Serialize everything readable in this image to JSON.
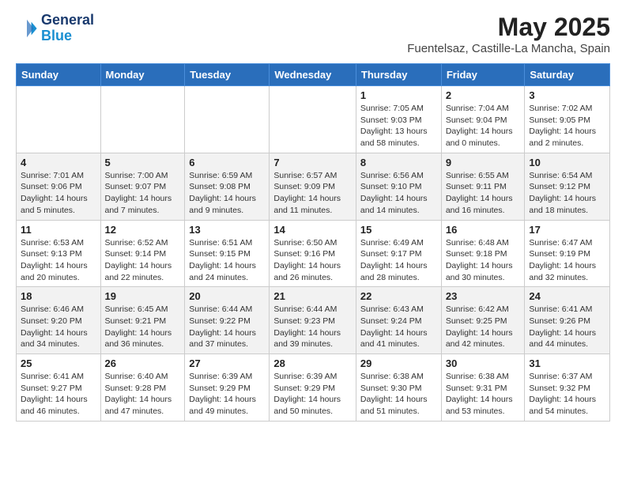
{
  "header": {
    "logo_line1": "General",
    "logo_line2": "Blue",
    "month_title": "May 2025",
    "location": "Fuentelsaz, Castille-La Mancha, Spain"
  },
  "days_of_week": [
    "Sunday",
    "Monday",
    "Tuesday",
    "Wednesday",
    "Thursday",
    "Friday",
    "Saturday"
  ],
  "weeks": [
    [
      {
        "day": "",
        "info": ""
      },
      {
        "day": "",
        "info": ""
      },
      {
        "day": "",
        "info": ""
      },
      {
        "day": "",
        "info": ""
      },
      {
        "day": "1",
        "info": "Sunrise: 7:05 AM\nSunset: 9:03 PM\nDaylight: 13 hours and 58 minutes."
      },
      {
        "day": "2",
        "info": "Sunrise: 7:04 AM\nSunset: 9:04 PM\nDaylight: 14 hours and 0 minutes."
      },
      {
        "day": "3",
        "info": "Sunrise: 7:02 AM\nSunset: 9:05 PM\nDaylight: 14 hours and 2 minutes."
      }
    ],
    [
      {
        "day": "4",
        "info": "Sunrise: 7:01 AM\nSunset: 9:06 PM\nDaylight: 14 hours and 5 minutes."
      },
      {
        "day": "5",
        "info": "Sunrise: 7:00 AM\nSunset: 9:07 PM\nDaylight: 14 hours and 7 minutes."
      },
      {
        "day": "6",
        "info": "Sunrise: 6:59 AM\nSunset: 9:08 PM\nDaylight: 14 hours and 9 minutes."
      },
      {
        "day": "7",
        "info": "Sunrise: 6:57 AM\nSunset: 9:09 PM\nDaylight: 14 hours and 11 minutes."
      },
      {
        "day": "8",
        "info": "Sunrise: 6:56 AM\nSunset: 9:10 PM\nDaylight: 14 hours and 14 minutes."
      },
      {
        "day": "9",
        "info": "Sunrise: 6:55 AM\nSunset: 9:11 PM\nDaylight: 14 hours and 16 minutes."
      },
      {
        "day": "10",
        "info": "Sunrise: 6:54 AM\nSunset: 9:12 PM\nDaylight: 14 hours and 18 minutes."
      }
    ],
    [
      {
        "day": "11",
        "info": "Sunrise: 6:53 AM\nSunset: 9:13 PM\nDaylight: 14 hours and 20 minutes."
      },
      {
        "day": "12",
        "info": "Sunrise: 6:52 AM\nSunset: 9:14 PM\nDaylight: 14 hours and 22 minutes."
      },
      {
        "day": "13",
        "info": "Sunrise: 6:51 AM\nSunset: 9:15 PM\nDaylight: 14 hours and 24 minutes."
      },
      {
        "day": "14",
        "info": "Sunrise: 6:50 AM\nSunset: 9:16 PM\nDaylight: 14 hours and 26 minutes."
      },
      {
        "day": "15",
        "info": "Sunrise: 6:49 AM\nSunset: 9:17 PM\nDaylight: 14 hours and 28 minutes."
      },
      {
        "day": "16",
        "info": "Sunrise: 6:48 AM\nSunset: 9:18 PM\nDaylight: 14 hours and 30 minutes."
      },
      {
        "day": "17",
        "info": "Sunrise: 6:47 AM\nSunset: 9:19 PM\nDaylight: 14 hours and 32 minutes."
      }
    ],
    [
      {
        "day": "18",
        "info": "Sunrise: 6:46 AM\nSunset: 9:20 PM\nDaylight: 14 hours and 34 minutes."
      },
      {
        "day": "19",
        "info": "Sunrise: 6:45 AM\nSunset: 9:21 PM\nDaylight: 14 hours and 36 minutes."
      },
      {
        "day": "20",
        "info": "Sunrise: 6:44 AM\nSunset: 9:22 PM\nDaylight: 14 hours and 37 minutes."
      },
      {
        "day": "21",
        "info": "Sunrise: 6:44 AM\nSunset: 9:23 PM\nDaylight: 14 hours and 39 minutes."
      },
      {
        "day": "22",
        "info": "Sunrise: 6:43 AM\nSunset: 9:24 PM\nDaylight: 14 hours and 41 minutes."
      },
      {
        "day": "23",
        "info": "Sunrise: 6:42 AM\nSunset: 9:25 PM\nDaylight: 14 hours and 42 minutes."
      },
      {
        "day": "24",
        "info": "Sunrise: 6:41 AM\nSunset: 9:26 PM\nDaylight: 14 hours and 44 minutes."
      }
    ],
    [
      {
        "day": "25",
        "info": "Sunrise: 6:41 AM\nSunset: 9:27 PM\nDaylight: 14 hours and 46 minutes."
      },
      {
        "day": "26",
        "info": "Sunrise: 6:40 AM\nSunset: 9:28 PM\nDaylight: 14 hours and 47 minutes."
      },
      {
        "day": "27",
        "info": "Sunrise: 6:39 AM\nSunset: 9:29 PM\nDaylight: 14 hours and 49 minutes."
      },
      {
        "day": "28",
        "info": "Sunrise: 6:39 AM\nSunset: 9:29 PM\nDaylight: 14 hours and 50 minutes."
      },
      {
        "day": "29",
        "info": "Sunrise: 6:38 AM\nSunset: 9:30 PM\nDaylight: 14 hours and 51 minutes."
      },
      {
        "day": "30",
        "info": "Sunrise: 6:38 AM\nSunset: 9:31 PM\nDaylight: 14 hours and 53 minutes."
      },
      {
        "day": "31",
        "info": "Sunrise: 6:37 AM\nSunset: 9:32 PM\nDaylight: 14 hours and 54 minutes."
      }
    ]
  ]
}
